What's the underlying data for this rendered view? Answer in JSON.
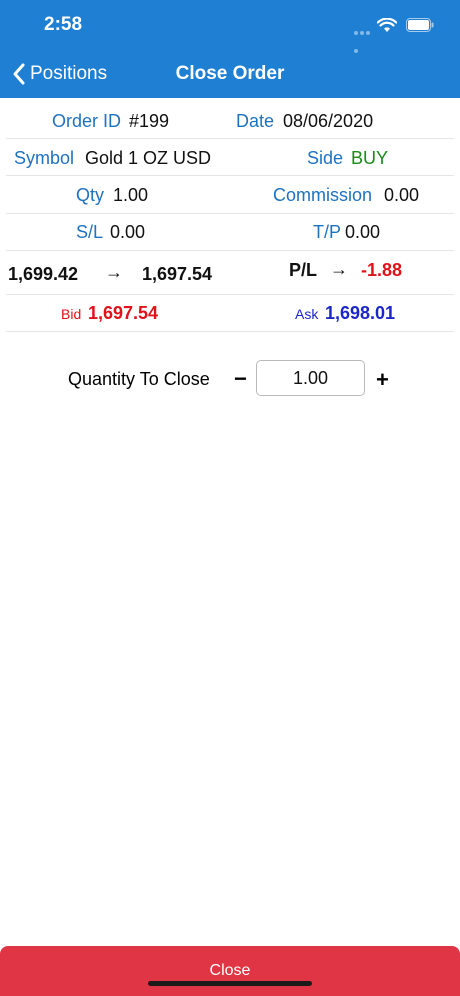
{
  "status": {
    "time": "2:58"
  },
  "nav": {
    "back_label": "Positions",
    "title": "Close Order"
  },
  "order": {
    "order_id_label": "Order ID",
    "order_id": "#199",
    "date_label": "Date",
    "date": "08/06/2020",
    "symbol_label": "Symbol",
    "symbol": "Gold 1 OZ USD",
    "side_label": "Side",
    "side": "BUY",
    "qty_label": "Qty",
    "qty": "1.00",
    "commission_label": "Commission",
    "commission": "0.00",
    "sl_label": "S/L",
    "sl": "0.00",
    "tp_label": "T/P",
    "tp": "0.00",
    "open_price": "1,699.42",
    "arrow": "→",
    "current_price": "1,697.54",
    "pl_label": "P/L",
    "pl_arrow": "→",
    "pl": "-1.88",
    "bid_label": "Bid",
    "bid": "1,697.54",
    "ask_label": "Ask",
    "ask": "1,698.01"
  },
  "close_form": {
    "quantity_label": "Quantity To Close",
    "minus": "−",
    "quantity": "1.00",
    "plus": "+"
  },
  "footer": {
    "close_label": "Close"
  },
  "colors": {
    "header": "#1f7fd3",
    "label": "#1f72c0",
    "buy": "#1a8a1a",
    "loss": "#e0121a",
    "ask": "#1d27c9",
    "close": "#e03545"
  }
}
